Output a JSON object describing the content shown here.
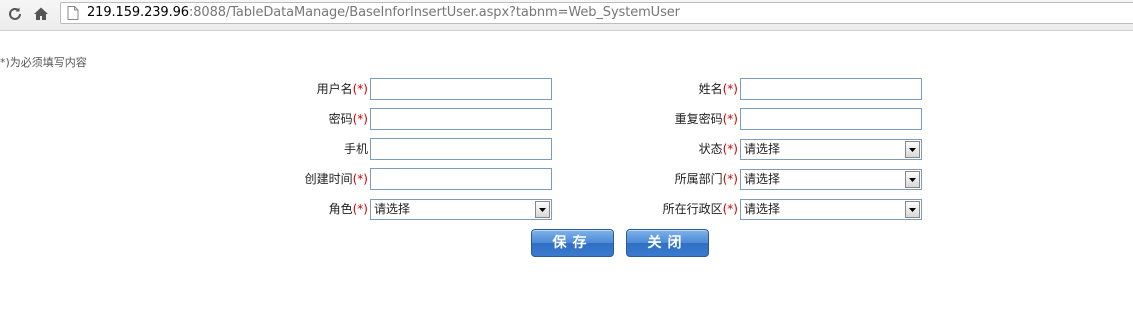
{
  "browser": {
    "url_host": "219.159.239.96",
    "url_rest": ":8088/TableDataManage/BaseInforInsertUser.aspx?tabnm=Web_SystemUser"
  },
  "form": {
    "required_note": "*)为必须填写内容",
    "required_mark": "(*)",
    "fields": {
      "username": {
        "label": "用户名",
        "value": ""
      },
      "fullname": {
        "label": "姓名",
        "value": ""
      },
      "password": {
        "label": "密码",
        "value": ""
      },
      "confirm_password": {
        "label": "重复密码",
        "value": ""
      },
      "mobile": {
        "label": "手机",
        "value": ""
      },
      "status": {
        "label": "状态",
        "selected": "请选择"
      },
      "created_time": {
        "label": "创建时间",
        "value": ""
      },
      "department": {
        "label": "所属部门",
        "selected": "请选择"
      },
      "role": {
        "label": "角色",
        "selected": "请选择"
      },
      "district": {
        "label": "所在行政区",
        "selected": "请选择"
      }
    },
    "buttons": {
      "save": "保存",
      "close": "关闭"
    }
  },
  "colors": {
    "required": "#d40000",
    "button": "#3a7bd0"
  }
}
